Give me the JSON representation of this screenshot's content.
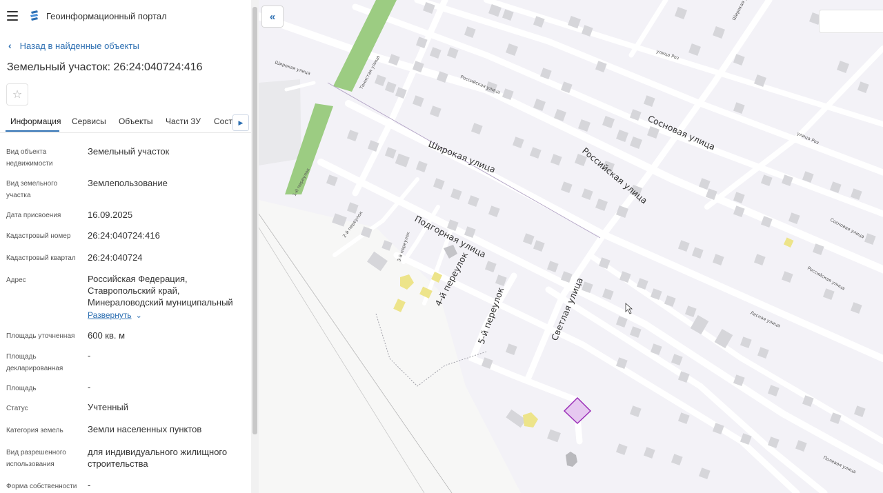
{
  "header": {
    "portal_title": "Геоинформационный портал"
  },
  "nav": {
    "back_label": "Назад в найденные объекты"
  },
  "object": {
    "title": "Земельный участок: 26:24:040724:416"
  },
  "tabs": [
    {
      "label": "Информация",
      "active": true
    },
    {
      "label": "Сервисы"
    },
    {
      "label": "Объекты"
    },
    {
      "label": "Части ЗУ"
    },
    {
      "label": "Соста"
    }
  ],
  "info": [
    {
      "label": "Вид объекта недвижимости",
      "value": "Земельный участок"
    },
    {
      "label": "Вид земельного участка",
      "value": "Землепользование"
    },
    {
      "label": "Дата присвоения",
      "value": "16.09.2025"
    },
    {
      "label": "Кадастровый номер",
      "value": "26:24:040724:416"
    },
    {
      "label": "Кадастровый квартал",
      "value": "26:24:040724"
    },
    {
      "label": "Адрес",
      "value": "Российская Федерация, Ставропольский край, Минераловодский муниципальный"
    },
    {
      "label": "Площадь уточненная",
      "value": "600 кв. м"
    },
    {
      "label": "Площадь декларированная",
      "value": "-"
    },
    {
      "label": "Площадь",
      "value": "-"
    },
    {
      "label": "Статус",
      "value": "Учтенный"
    },
    {
      "label": "Категория земель",
      "value": "Земли населенных пунктов"
    },
    {
      "label": "Вид разрешенного использования",
      "value": "для индивидуального жилищного строительства"
    },
    {
      "label": "Форма собственности",
      "value": "-"
    }
  ],
  "address_expand_label": "Развернуть",
  "map": {
    "streets": {
      "shirokaya": "Широкая улица",
      "rossiyskaya": "Российская улица",
      "sosnovaya": "Сосновая улица",
      "podgornaya": "Подгорная улица",
      "per4": "4-й переулок",
      "per5": "5-й переулок",
      "svetlaya": "Светлая улица",
      "small_shirokaya": "Широкая улица",
      "small_rossiyskaya": "Российская улица",
      "small_roz": "улица Роз",
      "small_roz2": "улица Роз",
      "small_sosnovaya": "Сосновая улица",
      "small_rossiyskaya2": "Российская улица",
      "small_per1": "1-й переулок",
      "small_per2": "2-й переулок",
      "small_per3": "3-й переулок",
      "small_tenistaya": "Тенистая улица",
      "small_shirokaya2": "Широкая улица",
      "small_lesnaya": "Лесная улица",
      "small_polevaya": "Полевая улица"
    },
    "highlight_color": "#e6c8f0",
    "highlight_border": "#9b2fb8"
  }
}
